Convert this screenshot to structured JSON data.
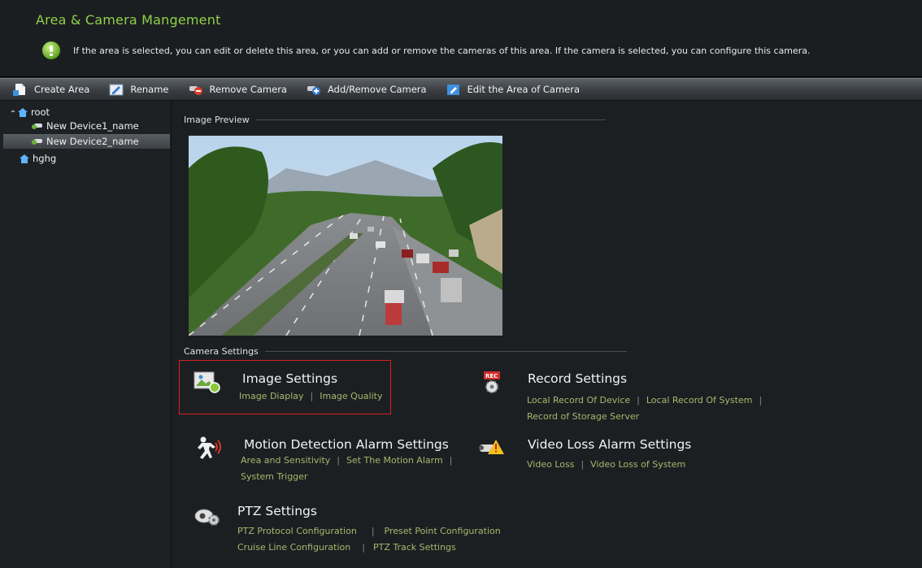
{
  "header": {
    "title": "Area & Camera Mangement",
    "info_icon": "info-bulb-icon",
    "info_text": "If the area is selected, you can edit or delete this area, or you can add or remove the cameras of this area. If the camera is selected, you can configure this camera."
  },
  "toolbar": {
    "create_area": "Create Area",
    "rename": "Rename",
    "remove_camera": "Remove Camera",
    "add_remove_camera": "Add/Remove Camera",
    "edit_area_of_camera": "Edit the Area of Camera"
  },
  "tree": {
    "root": "root",
    "device1": "New Device1_name",
    "device2": "New Device2_name",
    "area2": "hghg"
  },
  "main": {
    "image_preview_label": "Image Preview",
    "camera_settings_label": "Camera Settings",
    "image_settings": {
      "title": "Image Settings",
      "link1": "Image Diaplay",
      "link2": "Image Quality"
    },
    "record_settings": {
      "title": "Record Settings",
      "link1": "Local Record Of Device",
      "link2": "Local Record Of System",
      "link3": "Record of Storage Server"
    },
    "motion_settings": {
      "title": "Motion Detection Alarm Settings",
      "link1": "Area and Sensitivity",
      "link2": "Set The Motion Alarm",
      "link3": "System Trigger"
    },
    "video_loss_settings": {
      "title": "Video Loss Alarm Settings",
      "link1": "Video Loss",
      "link2": "Video Loss of System"
    },
    "ptz_settings": {
      "title": "PTZ Settings",
      "link1": "PTZ Protocol Configuration",
      "link2": "Preset Point Configuration",
      "link3": "Cruise Line Configuration",
      "link4": "PTZ Track Settings"
    },
    "separator": "|"
  },
  "colors": {
    "title_green": "#8fd14a",
    "link_olive": "#a7b86c",
    "highlight_red": "#d62020"
  }
}
